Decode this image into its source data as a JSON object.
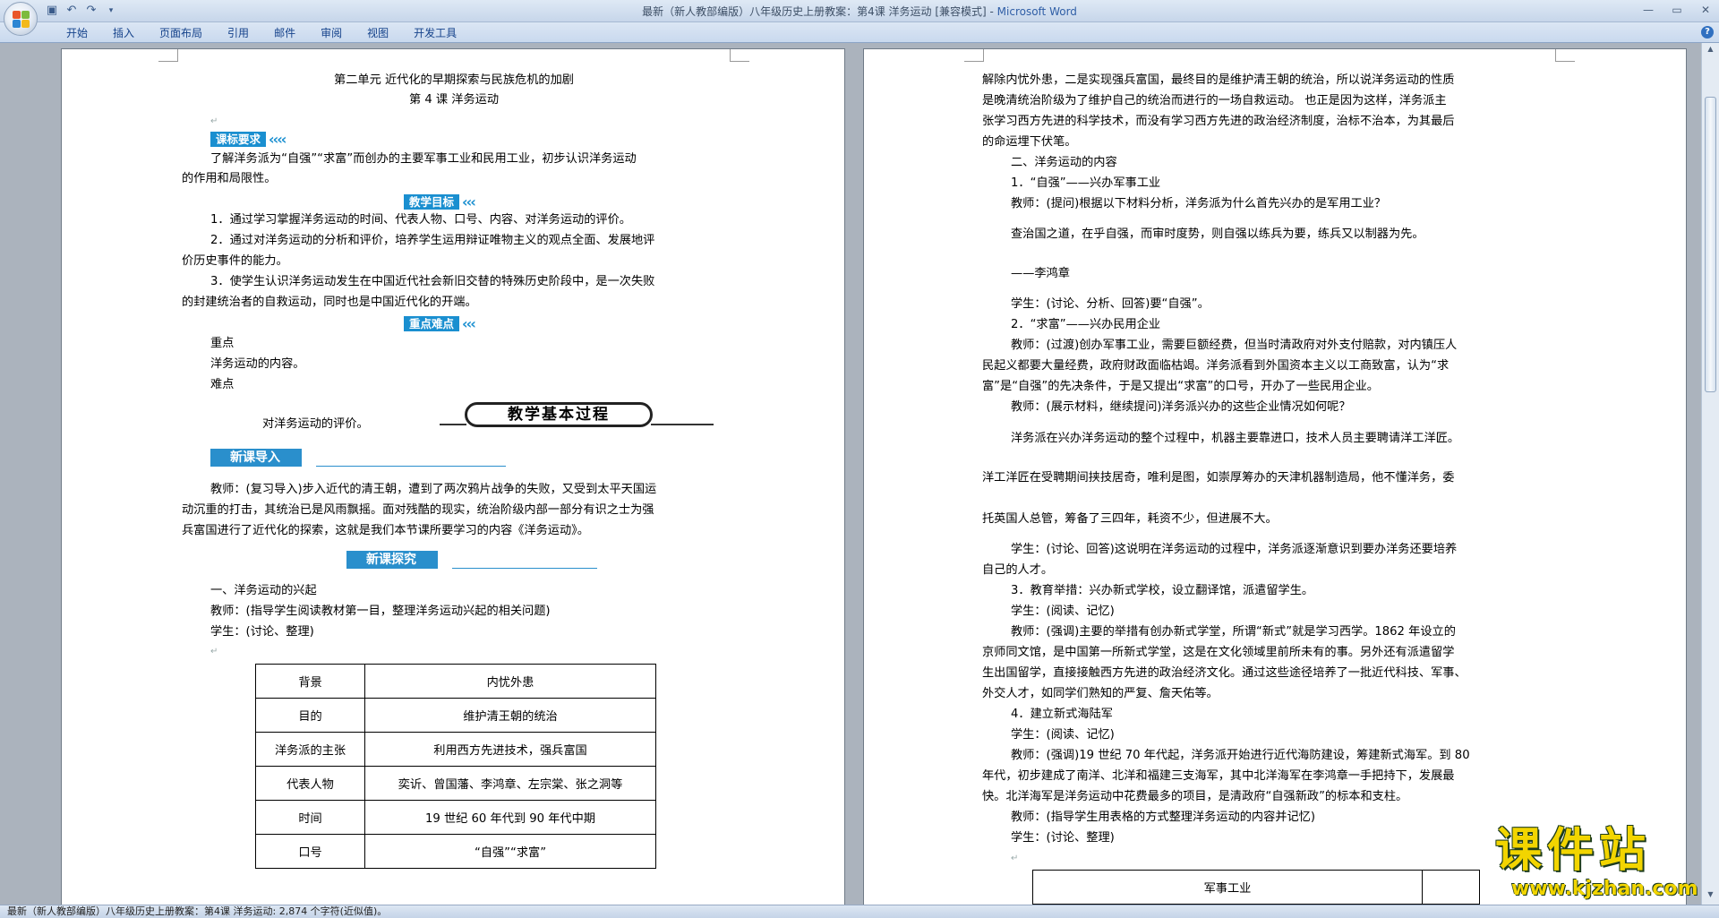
{
  "window": {
    "title_doc": "最新（新人教部编版）八年级历史上册教案：第4课   洋务运动 [兼容模式] - ",
    "title_app": "Microsoft Word"
  },
  "ribbon": {
    "tabs": [
      "开始",
      "插入",
      "页面布局",
      "引用",
      "邮件",
      "审阅",
      "视图",
      "开发工具"
    ]
  },
  "left_page": {
    "unit_title": "第二单元    近代化的早期探索与民族危机的加剧",
    "lesson_title": "第 4 课    洋务运动",
    "banner_requirements": "课标要求",
    "requirements_text": [
      "了解洋务派为“自强”“求富”而创办的主要军事工业和民用工业，初步认识洋务运动",
      "的作用和局限性。"
    ],
    "banner_goals": "教学目标",
    "goals": [
      "1．通过学习掌握洋务运动的时间、代表人物、口号、内容、对洋务运动的评价。",
      "2．通过对洋务运动的分析和评价，培养学生运用辩证唯物主义的观点全面、发展地评",
      "价历史事件的能力。",
      "3．使学生认识洋务运动发生在中国近代社会新旧交替的特殊历史阶段中，是一次失败",
      "的封建统治者的自救运动，同时也是中国近代化的开端。"
    ],
    "banner_key": "重点难点",
    "key_lines": [
      "重点",
      "洋务运动的内容。",
      "难点"
    ],
    "difficulty_text": "对洋务运动的评价。",
    "process_banner": "教学基本过程",
    "section_intro": "新课导入",
    "intro_para": [
      "教师：(复习导入)步入近代的清王朝，遭到了两次鸦片战争的失败，又受到太平天国运",
      "动沉重的打击，其统治已是风雨飘摇。面对残酷的现实，统治阶级内部一部分有识之士为强",
      "兵富国进行了近代化的探索，这就是我们本节课所要学习的内容《洋务运动》。"
    ],
    "section_explore": "新课探究",
    "explore_lines": [
      "一、洋务运动的兴起",
      "教师：(指导学生阅读教材第一目，整理洋务运动兴起的相关问题)",
      "学生：(讨论、整理)"
    ],
    "table": [
      [
        "背景",
        "内忧外患"
      ],
      [
        "目的",
        "维护清王朝的统治"
      ],
      [
        "洋务派的主张",
        "利用西方先进技术，强兵富国"
      ],
      [
        "代表人物",
        "奕䜣、曾国藩、李鸿章、左宗棠、张之洞等"
      ],
      [
        "时间",
        "19 世纪 60 年代到 90 年代中期"
      ],
      [
        "口号",
        "“自强”“求富”"
      ]
    ]
  },
  "right_page": {
    "lines_top": [
      "解除内忧外患，二是实现强兵富国，最终目的是维护清王朝的统治，所以说洋务运动的性质",
      "是晚清统治阶级为了维护自己的统治而进行的一场自救运动。  也正是因为这样，洋务派主",
      "张学习西方先进的科学技术，而没有学习西方先进的政治经济制度，治标不治本，为其最后",
      "的命运埋下伏笔。",
      "二、洋务运动的内容",
      "1．“自强”——兴办军事工业",
      "教师：(提问)根据以下材料分析，洋务派为什么首先兴办的是军用工业？"
    ],
    "quote1": "查治国之道，在乎自强，而审时度势，则自强以练兵为要，练兵又以制器为先。",
    "quote1_author": "——李鸿章",
    "lines_mid": [
      "学生：(讨论、分析、回答)要“自强”。",
      "2．“求富”——兴办民用企业",
      "教师：(过渡)创办军事工业，需要巨额经费，但当时清政府对外支付赔款，对内镇压人",
      "民起义都要大量经费，政府财政面临枯竭。洋务派看到外国资本主义以工商致富，认为“求",
      "富”是“自强”的先决条件，于是又提出“求富”的口号，开办了一些民用企业。",
      "教师：(展示材料，继续提问)洋务派兴办的这些企业情况如何呢？"
    ],
    "quote2_a": "洋务派在兴办洋务运动的整个过程中，机器主要靠进口，技术人员主要聘请洋工洋匠。",
    "quote2_b": "洋工洋匠在受聘期间挟技居奇，唯利是图，如崇厚筹办的天津机器制造局，他不懂洋务，委",
    "quote2_c": "托英国人总管，筹备了三四年，耗资不少，但进展不大。",
    "lines_bottom": [
      "学生：(讨论、回答)这说明在洋务运动的过程中，洋务派逐渐意识到要办洋务还要培养",
      "自己的人才。",
      "3．教育举措：兴办新式学校，设立翻译馆，派遣留学生。",
      "学生：(阅读、记忆)",
      "教师：(强调)主要的举措有创办新式学堂，所谓“新式”就是学习西学。1862 年设立的",
      "京师同文馆，是中国第一所新式学堂，这是在文化领域里前所未有的事。另外还有派遣留学",
      "生出国留学，直接接触西方先进的政治经济文化。通过这些途径培养了一批近代科技、军事、",
      "外交人才，如同学们熟知的严复、詹天佑等。",
      "4．建立新式海陆军",
      "学生：(阅读、记忆)",
      "教师：(强调)19 世纪 70 年代起，洋务派开始进行近代海防建设，筹建新式海军。到 80",
      "年代，初步建成了南洋、北洋和福建三支海军，其中北洋海军在李鸿章一手把持下，发展最",
      "快。北洋海军是洋务运动中花费最多的项目，是清政府“自强新政”的标本和支柱。",
      "教师：(指导学生用表格的方式整理洋务运动的内容并记忆)",
      "学生：(讨论、整理)"
    ],
    "table_header": "军事工业"
  },
  "statusbar": {
    "text": "最新（新人教部编版）八年级历史上册教案：第4课    洋务运动: 2,874 个字符(近似值)。"
  },
  "watermark": {
    "name": "课件站",
    "url": "www.kjzhan.com"
  }
}
